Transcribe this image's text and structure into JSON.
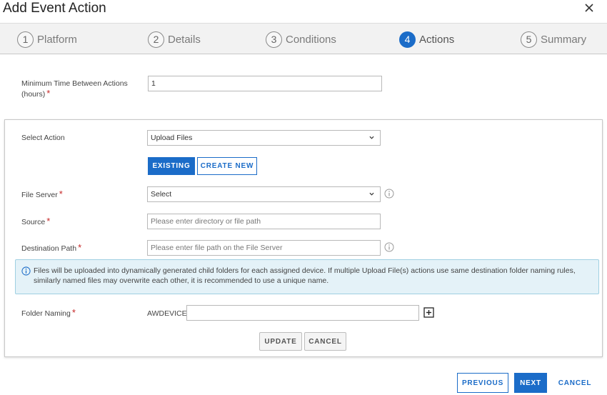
{
  "dialog": {
    "title": "Add Event Action"
  },
  "steps": [
    {
      "num": "1",
      "label": "Platform"
    },
    {
      "num": "2",
      "label": "Details"
    },
    {
      "num": "3",
      "label": "Conditions"
    },
    {
      "num": "4",
      "label": "Actions",
      "active": true
    },
    {
      "num": "5",
      "label": "Summary"
    }
  ],
  "form": {
    "min_time_label": "Minimum Time Between Actions (hours)",
    "min_time_value": "1",
    "select_action_label": "Select Action",
    "select_action_value": "Upload Files",
    "existing_label": "EXISTING",
    "create_new_label": "CREATE NEW",
    "file_server_label": "File Server",
    "file_server_value": "Select",
    "source_label": "Source",
    "source_placeholder": "Please enter directory or file path",
    "dest_label": "Destination Path",
    "dest_placeholder": "Please enter file path on the File Server",
    "info_text": "Files will be uploaded into dynamically generated child folders for each assigned device. If multiple Upload File(s) actions use same destination folder naming rules, similarly named files may overwrite each other, it is recommended to use a unique name.",
    "folder_naming_label": "Folder Naming",
    "folder_naming_prefix": "AWDEVICE_",
    "folder_naming_value": "",
    "update_label": "UPDATE",
    "cancel_label": "CANCEL",
    "required_mark": "*"
  },
  "footer": {
    "previous_label": "PREVIOUS",
    "next_label": "NEXT",
    "cancel_label": "CANCEL"
  },
  "colors": {
    "accent": "#1b6cc8",
    "required": "#c62828",
    "info_bg": "#e4f2f8"
  }
}
